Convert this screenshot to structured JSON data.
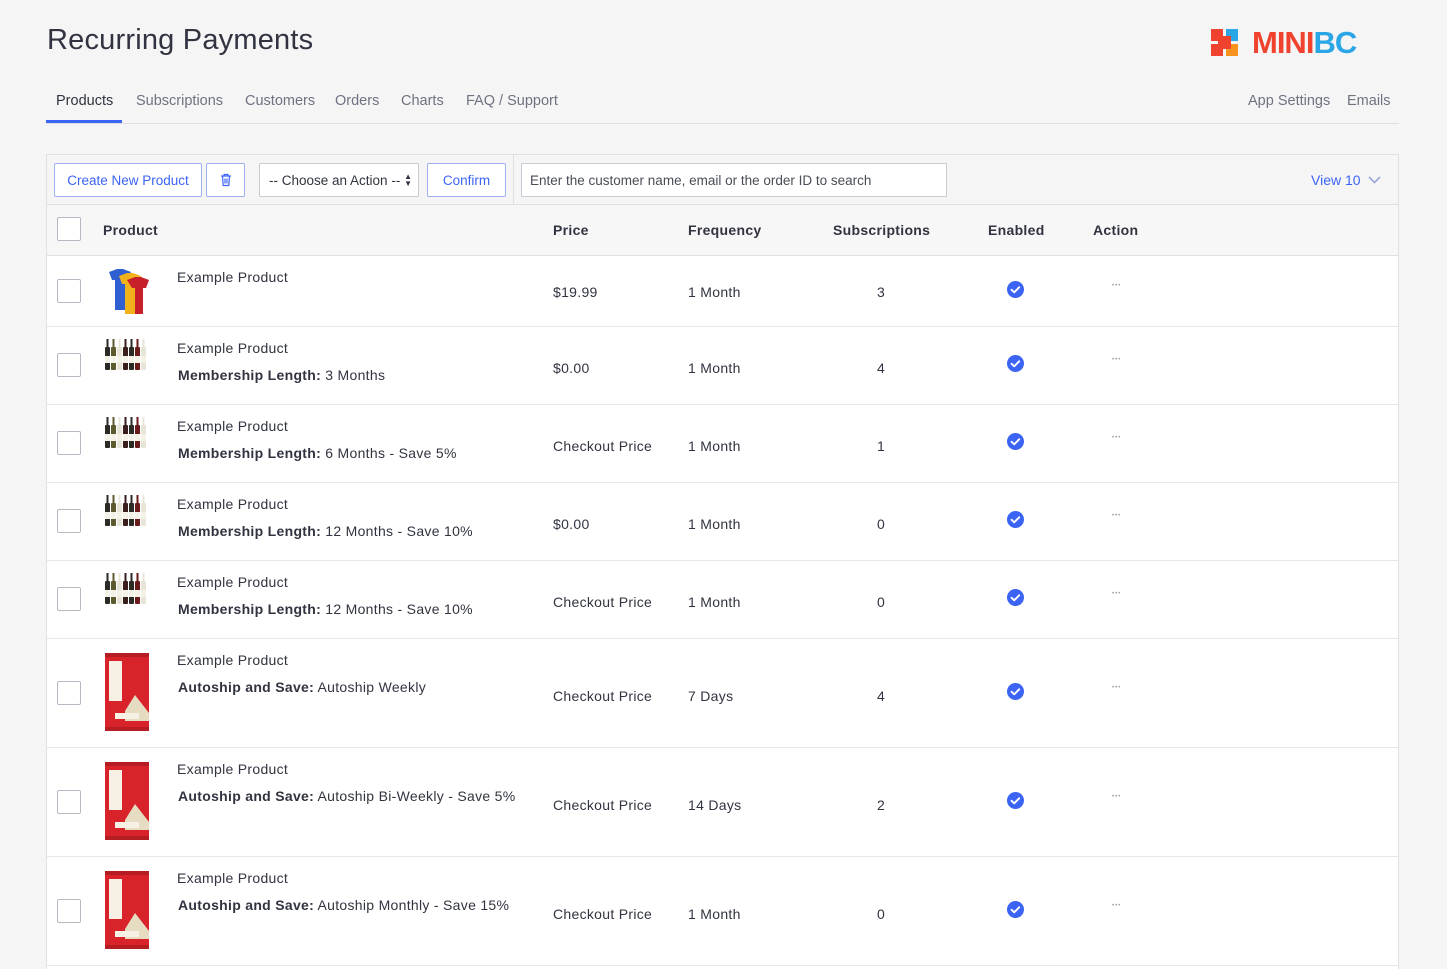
{
  "header": {
    "title": "Recurring Payments",
    "logo_text_a": "MINI",
    "logo_text_b": "BC"
  },
  "nav": {
    "tabs": [
      {
        "label": "Products",
        "active": true
      },
      {
        "label": "Subscriptions"
      },
      {
        "label": "Customers"
      },
      {
        "label": "Orders"
      },
      {
        "label": "Charts"
      },
      {
        "label": "FAQ / Support"
      }
    ],
    "right": [
      {
        "label": "App Settings"
      },
      {
        "label": "Emails"
      }
    ]
  },
  "toolbar": {
    "create_label": "Create New Product",
    "action_select_label": "-- Choose an Action --",
    "confirm_label": "Confirm",
    "search_placeholder": "Enter the customer name, email or the order ID to search",
    "view_label": "View 10"
  },
  "table": {
    "columns": {
      "product": "Product",
      "price": "Price",
      "frequency": "Frequency",
      "subscriptions": "Subscriptions",
      "enabled": "Enabled",
      "action": "Action"
    },
    "rows": [
      {
        "name": "Example Product",
        "option_label": "",
        "option_value": "",
        "price": "$19.99",
        "frequency": "1 Month",
        "subscriptions": "3",
        "enabled": true,
        "thumb": "shirts"
      },
      {
        "name": "Example Product",
        "option_label": "Membership Length:",
        "option_value": " 3 Months",
        "price": "$0.00",
        "frequency": "1 Month",
        "subscriptions": "4",
        "enabled": true,
        "thumb": "wine"
      },
      {
        "name": "Example Product",
        "option_label": "Membership Length:",
        "option_value": " 6 Months - Save 5%",
        "price": "Checkout Price",
        "frequency": "1 Month",
        "subscriptions": "1",
        "enabled": true,
        "thumb": "wine"
      },
      {
        "name": "Example Product",
        "option_label": "Membership Length:",
        "option_value": " 12 Months - Save 10%",
        "price": "$0.00",
        "frequency": "1 Month",
        "subscriptions": "0",
        "enabled": true,
        "thumb": "wine"
      },
      {
        "name": "Example Product",
        "option_label": "Membership Length:",
        "option_value": " 12 Months - Save 10%",
        "price": "Checkout Price",
        "frequency": "1 Month",
        "subscriptions": "0",
        "enabled": true,
        "thumb": "wine"
      },
      {
        "name": "Example Product",
        "option_label": "Autoship and Save:",
        "option_value": " Autoship Weekly",
        "price": "Checkout Price",
        "frequency": "7 Days",
        "subscriptions": "4",
        "enabled": true,
        "thumb": "bar"
      },
      {
        "name": "Example Product",
        "option_label": "Autoship and Save:",
        "option_value": " Autoship Bi-Weekly - Save 5%",
        "price": "Checkout Price",
        "frequency": "14 Days",
        "subscriptions": "2",
        "enabled": true,
        "thumb": "bar"
      },
      {
        "name": "Example Product",
        "option_label": "Autoship and Save:",
        "option_value": " Autoship Monthly - Save 15%",
        "price": "Checkout Price",
        "frequency": "1 Month",
        "subscriptions": "0",
        "enabled": true,
        "thumb": "bar"
      }
    ]
  },
  "colors": {
    "accent": "#3c64f4",
    "logo_red": "#f0432f",
    "logo_blue": "#2aa6e6",
    "logo_orange": "#f7931e"
  }
}
